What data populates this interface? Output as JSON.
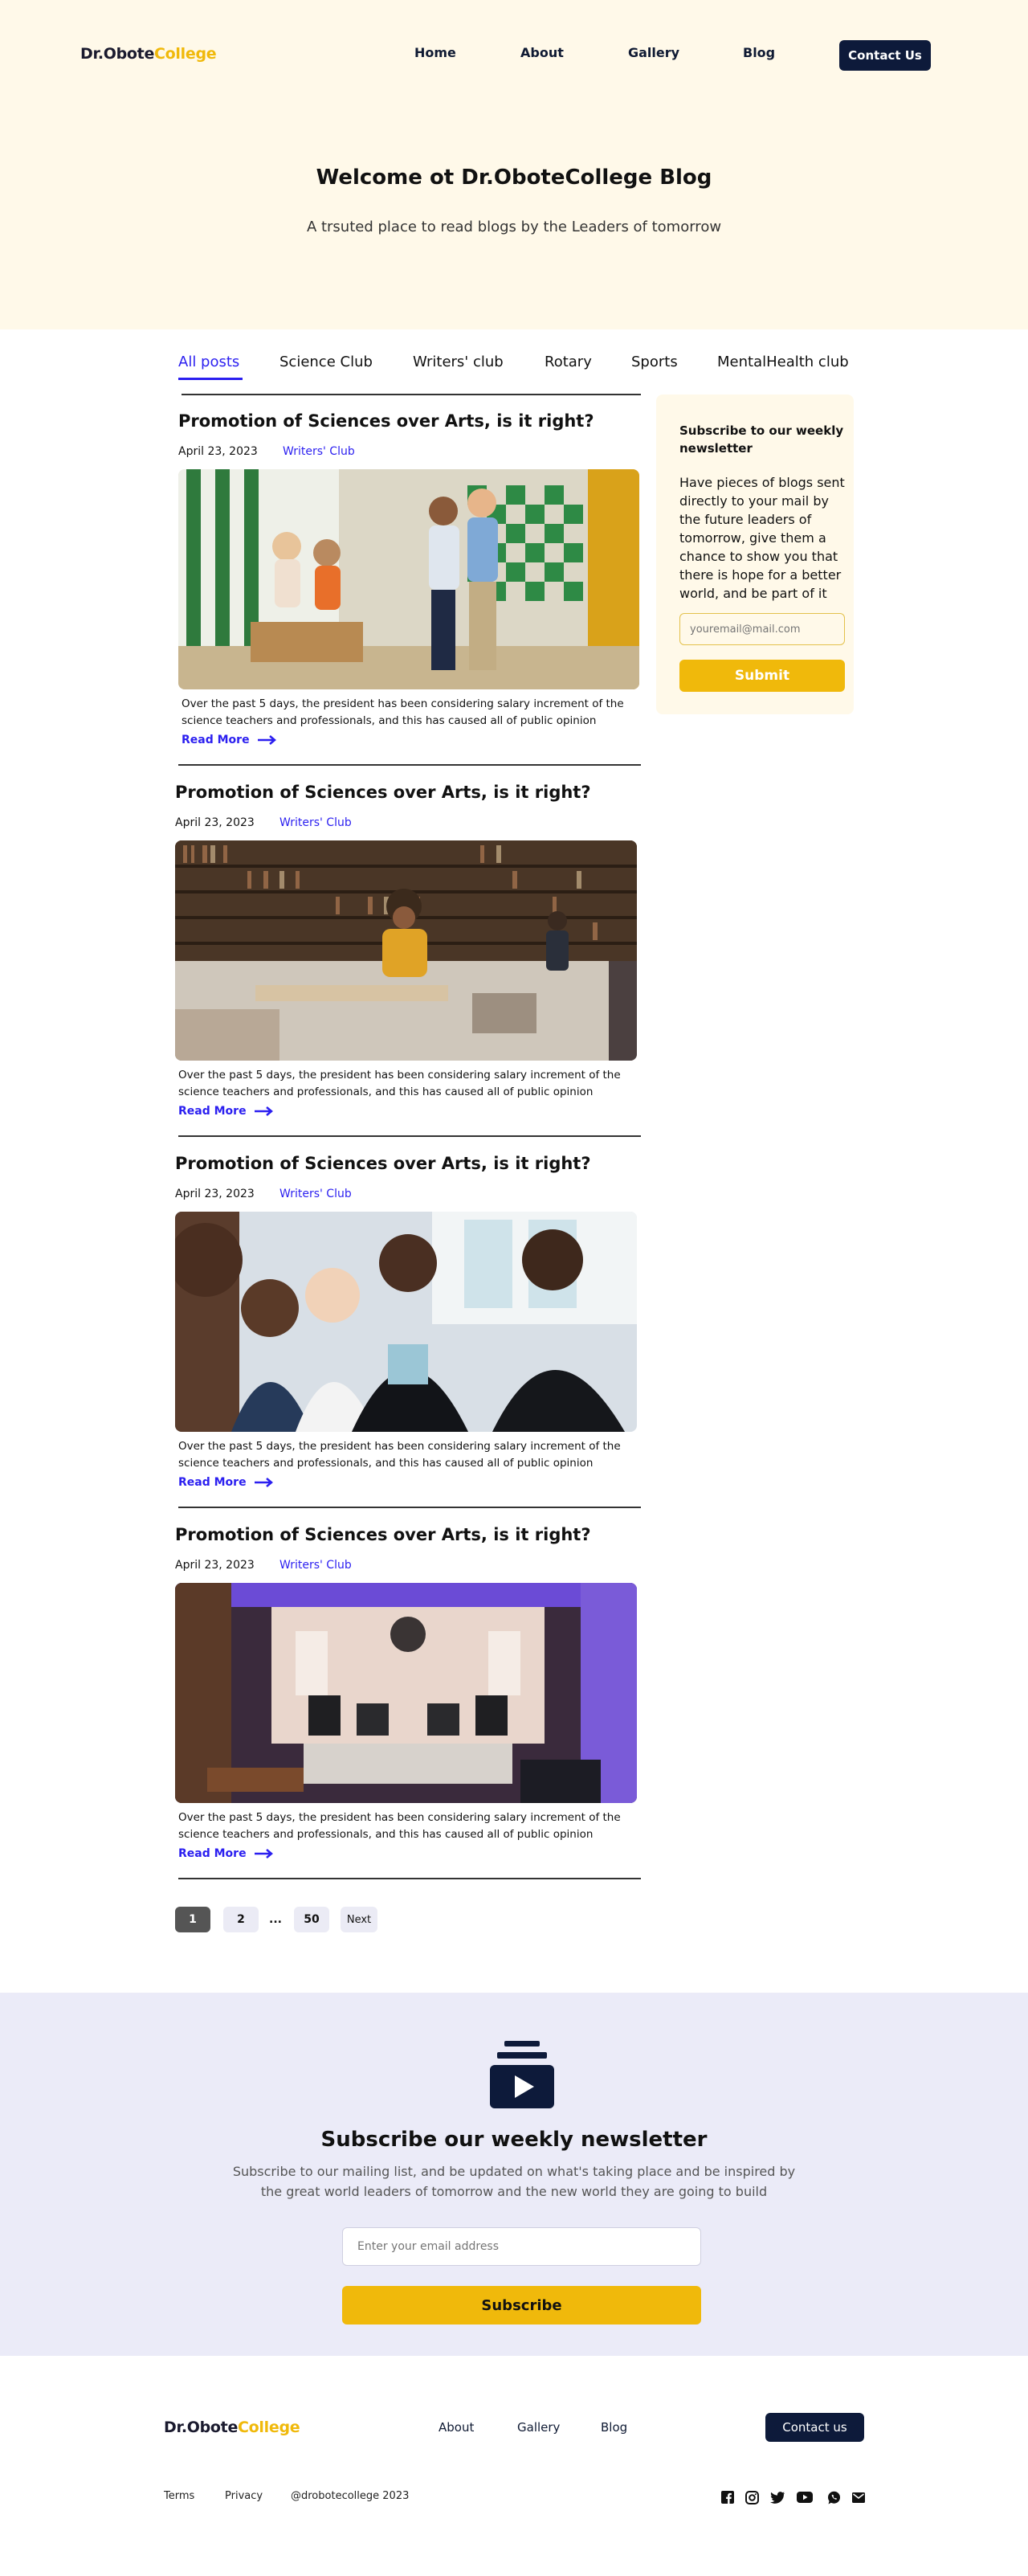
{
  "brand": {
    "name_part1": "Dr.Obote",
    "name_part2": "College",
    "accent_color": "#f0b90b",
    "dark_color": "#0d1a3a"
  },
  "header": {
    "nav": [
      "Home",
      "About",
      "Gallery",
      "Blog"
    ],
    "contact_label": "Contact Us"
  },
  "hero": {
    "title": "Welcome ot Dr.ObotеCollege Blog",
    "subtitle": "A trsuted place to read blogs by the Leaders of tomorrow"
  },
  "tabs": {
    "items": [
      "All posts",
      "Science Club",
      "Writers' club",
      "Rotary",
      "Sports",
      "MentalHealth club"
    ],
    "active_index": 0,
    "active_color": "#2b1ff0"
  },
  "posts": [
    {
      "title": "Promotion of Sciences over Arts, is it right?",
      "date": "April 23, 2023",
      "category": "Writers' Club",
      "image_icon": "classroom-children-photo",
      "excerpt": "Over the past 5 days, the president has been considering salary increment of the science teachers and professionals, and this has caused all of public opinion",
      "read_more": "Read More"
    },
    {
      "title": "Promotion of Sciences over Arts, is it right?",
      "date": "April 23, 2023",
      "category": "Writers' Club",
      "image_icon": "library-reading-photo",
      "excerpt": "Over the past 5 days, the president has been considering salary increment of the science teachers and professionals, and this has caused all of public opinion",
      "read_more": "Read More"
    },
    {
      "title": "Promotion of Sciences over Arts, is it right?",
      "date": "April 23, 2023",
      "category": "Writers' Club",
      "image_icon": "students-group-photo",
      "excerpt": "Over the past 5 days, the president has been considering salary increment of the science teachers and professionals, and this has caused all of public opinion",
      "read_more": "Read More"
    },
    {
      "title": "Promotion of Sciences over Arts, is it right?",
      "date": "April 23, 2023",
      "category": "Writers' Club",
      "image_icon": "music-studio-photo",
      "excerpt": "Over the past 5 days, the president has been considering salary increment of the science teachers and professionals, and this has caused all of public opinion",
      "read_more": "Read More"
    }
  ],
  "sidebar": {
    "title": "Subscribe to our weekly newsletter",
    "text": "Have pieces of blogs sent directly to your mail by the future leaders of tomorrow, give them a chance to show you that there is hope for a better world, and be part of it",
    "input_placeholder": "youremail@mail.com",
    "submit_label": "Submit"
  },
  "pagination": {
    "pages": [
      "1",
      "2",
      "...",
      "50"
    ],
    "current": "1",
    "next_label": "Next"
  },
  "newsletter": {
    "icon": "newsletter-video-icon",
    "title": "Subscribe our weekly newsletter",
    "subtitle": "Subscribe to our mailing list, and be updated on what's taking place and be inspired by the great world leaders of tomorrow and the new world they are going to build",
    "input_placeholder": "Enter your email address",
    "button_label": "Subscribe"
  },
  "footer": {
    "nav": [
      "About",
      "Gallery",
      "Blog"
    ],
    "contact_label": "Contact us",
    "links": [
      "Terms",
      "Privacy"
    ],
    "copyright": "@drobotecollege 2023",
    "social_icons": [
      "facebook-icon",
      "instagram-icon",
      "twitter-icon",
      "youtube-icon",
      "whatsapp-icon",
      "mail-icon"
    ]
  }
}
